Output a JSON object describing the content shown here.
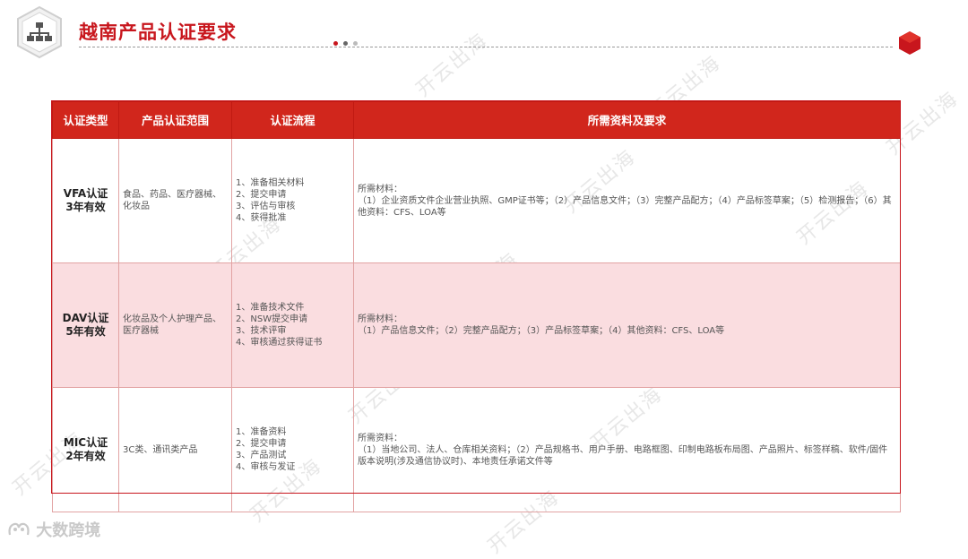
{
  "page": {
    "title": "越南产品认证要求",
    "accent": "#c8161d",
    "brand": "大数跨境",
    "watermark": "开云出海"
  },
  "table": {
    "headers": [
      "认证类型",
      "产品认证范围",
      "认证流程",
      "所需资料及要求"
    ],
    "rows": [
      {
        "type_lines": [
          "VFA认证",
          "3年有效"
        ],
        "scope": "食品、药品、医疗器械、化妆品",
        "process": [
          "1、准备相关材料",
          "2、提交申请",
          "3、评估与审核",
          "4、获得批准"
        ],
        "req_head": "所需材料：",
        "req_body": "（1）企业资质文件企业营业执照、GMP证书等；（2）产品信息文件；（3）完整产品配方；（4）产品标签草案；（5）检测报告；（6）其他资料：CFS、LOA等"
      },
      {
        "type_lines": [
          "DAV认证",
          "5年有效"
        ],
        "scope": "化妆品及个人护理产品、医疗器械",
        "process": [
          "1、准备技术文件",
          "2、NSW提交申请",
          "3、技术评审",
          "4、审核通过获得证书"
        ],
        "req_head": "所需材料：",
        "req_body": "（1）产品信息文件；（2）完整产品配方；（3）产品标签草案；（4）其他资料：CFS、LOA等"
      },
      {
        "type_lines": [
          "MIC认证",
          "2年有效"
        ],
        "scope": "3C类、通讯类产品",
        "process": [
          "1、准备资料",
          "2、提交申请",
          "3、产品测试",
          "4、审核与发证"
        ],
        "req_head": "所需资料：",
        "req_body": "（1）当地公司、法人、仓库相关资料；（2）产品规格书、用户手册、电路框图、印制电路板布局图、产品照片、标签样稿、软件/固件版本说明(涉及通信协议时)、本地责任承诺文件等"
      }
    ]
  }
}
